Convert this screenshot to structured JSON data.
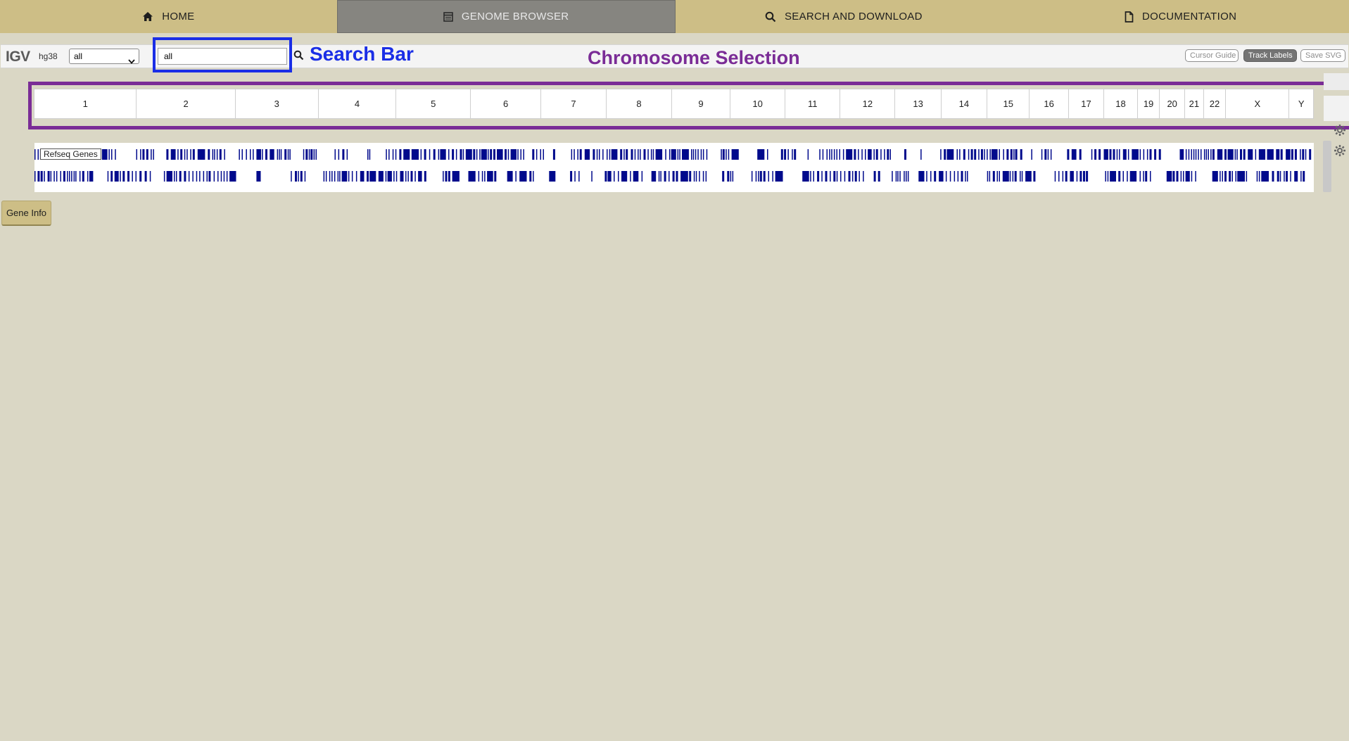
{
  "nav": {
    "items": [
      {
        "label": "HOME",
        "icon": "home-icon"
      },
      {
        "label": "GENOME BROWSER",
        "icon": "browser-icon"
      },
      {
        "label": "SEARCH AND DOWNLOAD",
        "icon": "search-icon"
      },
      {
        "label": "DOCUMENTATION",
        "icon": "document-icon"
      }
    ],
    "active": "GENOME BROWSER"
  },
  "toolbar": {
    "logo": "IGV",
    "genome": "hg38",
    "chromosome_select": "all",
    "search_value": "all",
    "buttons": {
      "cursor_guide": "Cursor Guide",
      "track_labels": "Track Labels",
      "save_svg": "Save SVG"
    }
  },
  "annotations": {
    "search_bar": "Search Bar",
    "chromosome_selection": "Chromosome Selection"
  },
  "chromosomes": [
    "1",
    "2",
    "3",
    "4",
    "5",
    "6",
    "7",
    "8",
    "9",
    "10",
    "11",
    "12",
    "13",
    "14",
    "15",
    "16",
    "17",
    "18",
    "19",
    "20",
    "21",
    "22",
    "X",
    "Y"
  ],
  "track": {
    "label": "Refseq Genes"
  },
  "gene_info_button": "Gene Info",
  "colors": {
    "nav_bg": "#cdbe86",
    "nav_active": "#868580",
    "page_bg": "#dad7c5",
    "search_annotation": "#1a2ee6",
    "chrom_annotation": "#7a2c96",
    "gene_feature": "#000a8c"
  }
}
